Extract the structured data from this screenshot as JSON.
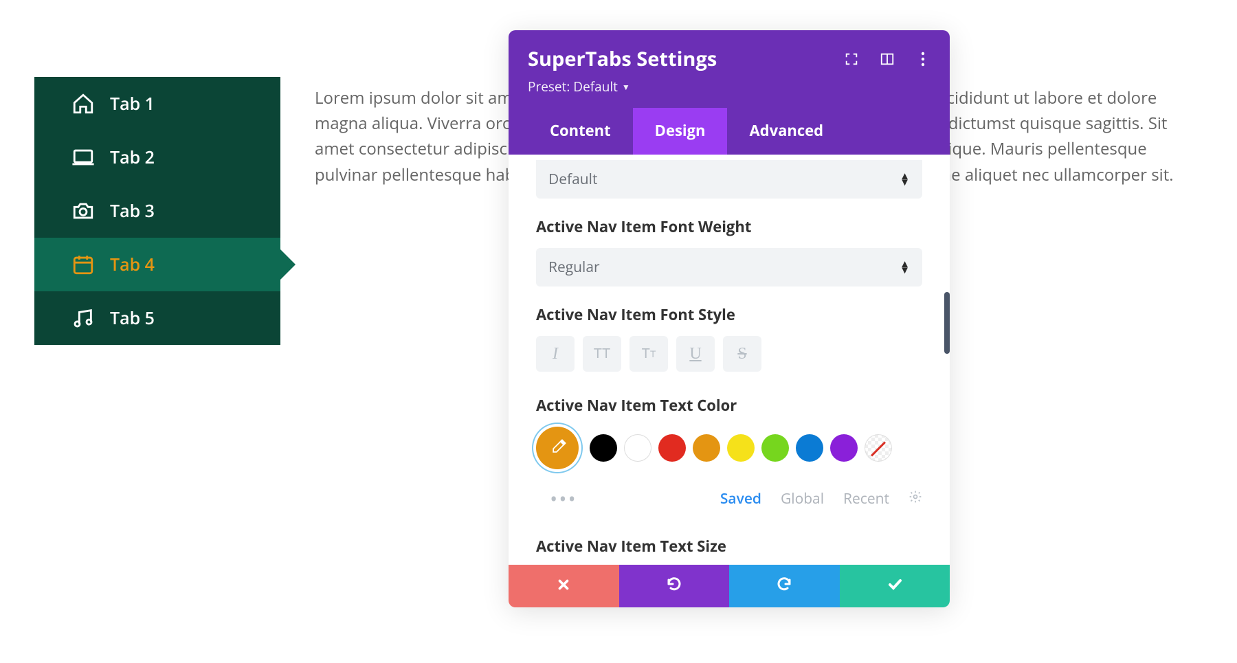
{
  "sidebar": {
    "items": [
      {
        "label": "Tab 1",
        "icon": "home-icon"
      },
      {
        "label": "Tab 2",
        "icon": "laptop-icon"
      },
      {
        "label": "Tab 3",
        "icon": "camera-icon"
      },
      {
        "label": "Tab 4",
        "icon": "calendar-icon"
      },
      {
        "label": "Tab 5",
        "icon": "music-icon"
      }
    ],
    "active_index": 3,
    "active_color": "#e49512",
    "bg_color": "#0b4536",
    "active_bg_color": "#0e6a52"
  },
  "body_text": "Lorem ipsum dolor sit amet, consectetur adipiscing elit, sed do eiusmod tempor incididunt ut labore et dolore magna aliqua. Viverra orci sagittis eu volutpat odio. Cursus in hac habitasse platea dictumst quisque sagittis. Sit amet consectetur adipiscing elit. Aenean sed adipiscing diam donec adipiscing tristique. Mauris pellentesque pulvinar pellentesque habitant morbi. Fusce id velit ut tortor pretium. Faucibus vitae aliquet nec ullamcorper sit.",
  "modal": {
    "title": "SuperTabs Settings",
    "preset_label": "Preset: Default",
    "tabs": [
      "Content",
      "Design",
      "Advanced"
    ],
    "active_tab": "Design",
    "header_accent": "#6b2fb5",
    "active_tab_accent": "#9a3df2",
    "body": {
      "partial_select_value": "Default",
      "font_weight": {
        "label": "Active Nav Item Font Weight",
        "value": "Regular"
      },
      "font_style": {
        "label": "Active Nav Item Font Style",
        "options": [
          "italic",
          "uppercase",
          "titlecase",
          "underline",
          "strikethrough"
        ]
      },
      "text_color": {
        "label": "Active Nav Item Text Color",
        "picker_current": "#e49512",
        "swatches": [
          "#000000",
          "#ffffff",
          "#e12b20",
          "#e49512",
          "#f5e11a",
          "#76d61e",
          "#0b7bd4",
          "#8a20d9",
          "transparent"
        ],
        "sub_tabs": [
          "Saved",
          "Global",
          "Recent"
        ],
        "sub_active": "Saved"
      },
      "text_size": {
        "label": "Active Nav Item Text Size"
      }
    },
    "footer": {
      "cancel": "close",
      "undo": "undo",
      "redo": "redo",
      "save": "check"
    }
  }
}
